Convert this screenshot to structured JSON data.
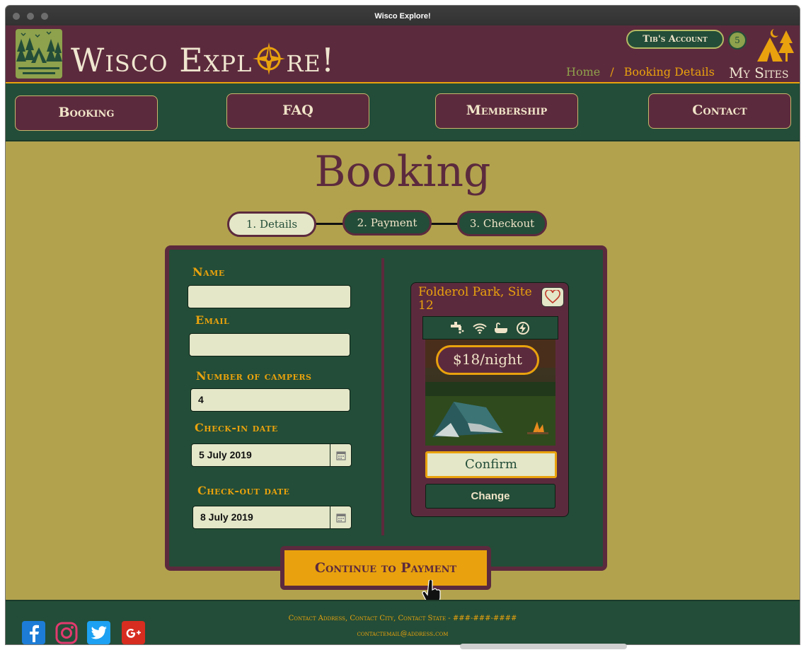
{
  "window": {
    "title": "Wisco Explore!"
  },
  "header": {
    "brand": "Wisco Explore!",
    "brand_left": "Wisco Expl",
    "brand_right": "re!",
    "account_label": "Tib's Account",
    "cart_count": "5",
    "breadcrumbs": [
      "Home",
      "/",
      "Booking Details"
    ],
    "my_sites_label": "My Sites"
  },
  "nav": {
    "items": [
      {
        "label": "Booking"
      },
      {
        "label": "FAQ"
      },
      {
        "label": "Membership"
      },
      {
        "label": "Contact"
      }
    ]
  },
  "page": {
    "title": "Booking"
  },
  "steps": [
    {
      "label": "1. Details",
      "state": "current"
    },
    {
      "label": "2. Payment",
      "state": "upcoming"
    },
    {
      "label": "3. Checkout",
      "state": "upcoming"
    }
  ],
  "form": {
    "name_label": "Name",
    "name_value": "",
    "email_label": "Email",
    "email_value": "",
    "campers_label": "Number of campers",
    "campers_value": "4",
    "checkin_label": "Check-in date",
    "checkin_value": "5 July 2019",
    "checkout_label": "Check-out date",
    "checkout_value": "8 July 2019"
  },
  "site": {
    "name": "Folderol Park, Site 12",
    "price": "$18/night",
    "amenities": [
      "water-icon",
      "wifi-icon",
      "bath-icon",
      "electric-icon"
    ],
    "confirm_label": "Confirm",
    "change_label": "Change"
  },
  "actions": {
    "continue_label": "Continue to Payment"
  },
  "footer": {
    "address": "Contact Address, Contact City, Contact State - ###-###-####",
    "email": "contactemail@address.com",
    "social": [
      "facebook-icon",
      "instagram-icon",
      "twitter-icon",
      "google-plus-icon"
    ]
  },
  "colors": {
    "maroon": "#5c2a3d",
    "forest": "#234d38",
    "gold": "#e9a20d",
    "olive": "#b2a24e",
    "cream": "#e4e7c8"
  }
}
